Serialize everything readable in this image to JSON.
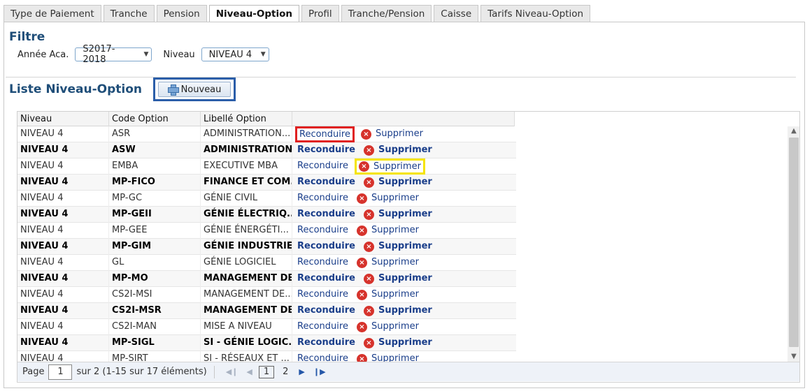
{
  "tabs": [
    {
      "label": "Type de Paiement",
      "active": false
    },
    {
      "label": "Tranche",
      "active": false
    },
    {
      "label": "Pension",
      "active": false
    },
    {
      "label": "Niveau-Option",
      "active": true
    },
    {
      "label": "Profil",
      "active": false
    },
    {
      "label": "Tranche/Pension",
      "active": false
    },
    {
      "label": "Caisse",
      "active": false
    },
    {
      "label": "Tarifs Niveau-Option",
      "active": false
    }
  ],
  "filter": {
    "title": "Filtre",
    "year_label": "Année Aca.",
    "year_value": "S2017-2018",
    "level_label": "Niveau",
    "level_value": "NIVEAU 4"
  },
  "list": {
    "title": "Liste Niveau-Option",
    "new_button": "Nouveau",
    "columns": [
      "Niveau",
      "Code Option",
      "Libellé Option",
      ""
    ],
    "action_renew": "Reconduire",
    "action_delete": "Supprimer",
    "rows": [
      {
        "niveau": "NIVEAU 4",
        "code": "ASR",
        "libelle": "ADMINISTRATION..."
      },
      {
        "niveau": "NIVEAU 4",
        "code": "ASW",
        "libelle": "ADMINISTRATION..."
      },
      {
        "niveau": "NIVEAU 4",
        "code": "EMBA",
        "libelle": "EXECUTIVE MBA"
      },
      {
        "niveau": "NIVEAU 4",
        "code": "MP-FICO",
        "libelle": "FINANCE ET COM..."
      },
      {
        "niveau": "NIVEAU 4",
        "code": "MP-GC",
        "libelle": "GÉNIE CIVIL"
      },
      {
        "niveau": "NIVEAU 4",
        "code": "MP-GEII",
        "libelle": "GÉNIE ÉLECTRIQ..."
      },
      {
        "niveau": "NIVEAU 4",
        "code": "MP-GEE",
        "libelle": "GÉNIE ÉNERGÉTI..."
      },
      {
        "niveau": "NIVEAU 4",
        "code": "MP-GIM",
        "libelle": "GÉNIE INDUSTRIE..."
      },
      {
        "niveau": "NIVEAU 4",
        "code": "GL",
        "libelle": "GÉNIE LOGICIEL"
      },
      {
        "niveau": "NIVEAU 4",
        "code": "MP-MO",
        "libelle": "MANAGEMENT DE..."
      },
      {
        "niveau": "NIVEAU 4",
        "code": "CS2I-MSI",
        "libelle": "MANAGEMENT DE..."
      },
      {
        "niveau": "NIVEAU 4",
        "code": "CS2I-MSR",
        "libelle": "MANAGEMENT DE..."
      },
      {
        "niveau": "NIVEAU 4",
        "code": "CS2I-MAN",
        "libelle": "MISE A NIVEAU"
      },
      {
        "niveau": "NIVEAU 4",
        "code": "MP-SIGL",
        "libelle": "SI - GÉNIE LOGIC..."
      },
      {
        "niveau": "NIVEAU 4",
        "code": "MP-SIRT",
        "libelle": "SI - RÉSEAUX ET ..."
      }
    ]
  },
  "pager": {
    "page_label": "Page",
    "page_value": "1",
    "total_text": "sur 2 (1-15 sur 17 éléments)",
    "pages": [
      "1",
      "2"
    ]
  },
  "icons": {
    "new": "plus-icon",
    "delete": "delete-circle-icon"
  },
  "colors": {
    "title": "#1f4e79",
    "link": "#1a3e8a",
    "delete_icon": "#d6332c",
    "highlight_red": "#e02020",
    "highlight_yellow": "#f5e400",
    "highlight_blue": "#2b5ea9"
  }
}
